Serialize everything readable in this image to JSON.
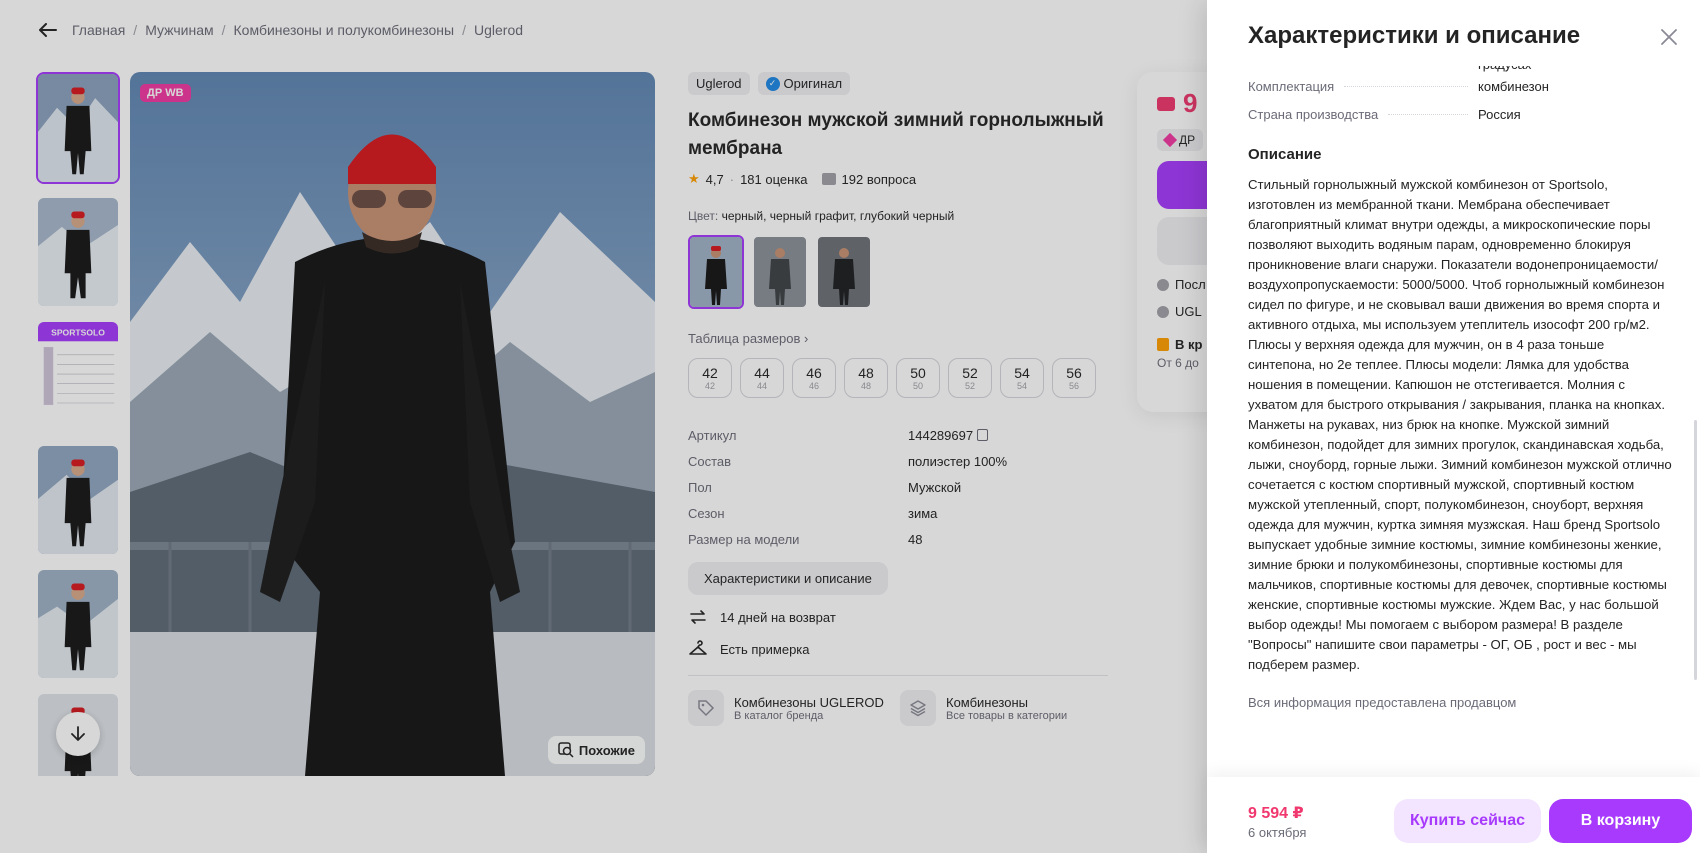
{
  "breadcrumbs": [
    "Главная",
    "Мужчинам",
    "Комбинезоны и полукомбинезоны",
    "Uglerod"
  ],
  "gallery": {
    "badge": "ДР WB",
    "similar_label": "Похожие",
    "thumb_brand": "SPORTSOLO"
  },
  "product": {
    "brand": "Uglerod",
    "original_label": "Оригинал",
    "title": "Комбинезон мужской зимний горнолыжный мембрана",
    "rating": "4,7",
    "reviews": "181 оценка",
    "questions": "192 вопроса",
    "color_label": "Цвет:",
    "color_value": "черный, черный графит, глубокий черный",
    "size_table_label": "Таблица размеров",
    "sizes": [
      {
        "main": "42",
        "sub": "42"
      },
      {
        "main": "44",
        "sub": "44"
      },
      {
        "main": "46",
        "sub": "46"
      },
      {
        "main": "48",
        "sub": "48"
      },
      {
        "main": "50",
        "sub": "50"
      },
      {
        "main": "52",
        "sub": "52"
      },
      {
        "main": "54",
        "sub": "54"
      },
      {
        "main": "56",
        "sub": "56"
      }
    ],
    "specs": [
      {
        "name": "Артикул",
        "value": "144289697"
      },
      {
        "name": "Состав",
        "value": "полиэстер 100%"
      },
      {
        "name": "Пол",
        "value": "Мужской"
      },
      {
        "name": "Сезон",
        "value": "зима"
      },
      {
        "name": "Размер на модели",
        "value": "48"
      }
    ],
    "char_button": "Характеристики и описание",
    "features": [
      "14 дней на возврат",
      "Есть примерка"
    ],
    "links": [
      {
        "title": "Комбинезоны UGLEROD",
        "sub": "В каталог бренда"
      },
      {
        "title": "Комбинезоны",
        "sub": "Все товары в категории"
      }
    ]
  },
  "price_card": {
    "price_partial": "9",
    "dr_partial": "ДР",
    "row1_partial": "Посл",
    "row2_partial": "UGL",
    "delivery_partial": "В кр",
    "delivery_sub_partial": "От 6 до"
  },
  "panel": {
    "title": "Характеристики и описание",
    "cut_spec": {
      "name": "",
      "value": "градусах"
    },
    "specs": [
      {
        "name": "Комплектация",
        "value": "комбинезон"
      },
      {
        "name": "Страна производства",
        "value": "Россия"
      }
    ],
    "description_title": "Описание",
    "description": "Стильный горнолыжный мужской комбинезон от Sportsolo, изготовлен из мембранной ткани. Мембрана обеспечивает благоприятный климат внутри одежды, а микроскопические поры позволяют выходить водяным парам, одновременно блокируя проникновение влаги снаружи. Показатели водонепроницаемости/воздухопропускаемости: 5000/5000. Чтоб горнолыжный комбинезон сидел по фигуре, и не сковывал ваши движения во время спорта и активного отдыха, мы используем утеплитель изософт 200 гр/м2. Плюсы у верхняя одежда для мужчин, он в 4 раза тоньше синтепона, но 2е теплее. Плюсы модели: Лямка для удобства ношения в помещении. Капюшон не отстегивается. Молния с ухватом для быстрого открывания / закрывания, планка на кнопках. Манжеты на рукавах, низ брюк на кнопке. Мужской зимний комбинезон, подойдет для зимних прогулок, скандинавская ходьба, лыжи, сноуборд, горные лыжи. Зимний комбинезон мужской отлично сочетается с костюм спортивный мужской, спортивный костюм мужской утепленный, спорт, полукомбинезон, сноуборт, верхняя одежда для мужчин, куртка зимняя музжская. Наш бренд Sportsolo выпускает удобные зимние костюмы, зимние комбинезоны женкие, зимние брюки и полукомбинезоны, спортивные костюмы для мальчиков, спортивные костюмы для девочек, спортивные костюмы женские, спортивные костюмы мужские. Ждем Вас, у нас большой выбор одежды! Мы помогаем с выбором размера! В разделе \"Вопросы\" напишите свои параметры - ОГ, ОБ , рост и вес - мы подберем размер.",
    "seller_note": "Вся информация предоставлена продавцом",
    "footer": {
      "price": "9 594 ₽",
      "date": "6 октября",
      "buy_now": "Купить сейчас",
      "to_cart": "В корзину"
    }
  },
  "colors": {
    "accent": "#a73afd",
    "price": "#f0386e",
    "badge": "#f239a3"
  }
}
